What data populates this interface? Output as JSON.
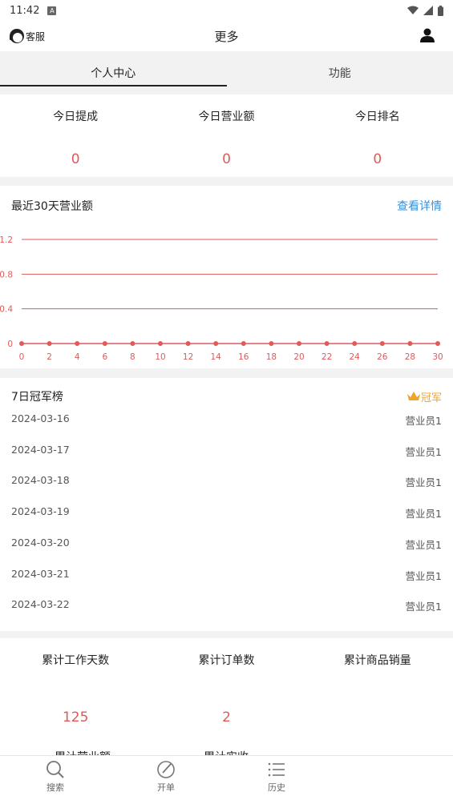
{
  "status": {
    "time": "11:42",
    "a_icon": "A"
  },
  "topbar": {
    "cs_label": "客服",
    "title": "更多"
  },
  "tabs": [
    {
      "label": "个人中心",
      "active": true
    },
    {
      "label": "功能",
      "active": false
    }
  ],
  "today": [
    {
      "label": "今日提成",
      "value": "0"
    },
    {
      "label": "今日营业额",
      "value": "0"
    },
    {
      "label": "今日排名",
      "value": "0"
    }
  ],
  "chart_header": {
    "title": "最近30天营业额",
    "link": "查看详情"
  },
  "chart_data": {
    "type": "line",
    "x": [
      0,
      1,
      2,
      3,
      4,
      5,
      6,
      7,
      8,
      9,
      10,
      11,
      12,
      13,
      14,
      15,
      16,
      17,
      18,
      19,
      20,
      21,
      22,
      23,
      24,
      25,
      26,
      27,
      28,
      29,
      30
    ],
    "series": [
      {
        "values": [
          0,
          0,
          0,
          0,
          0,
          0,
          0,
          0,
          0,
          0,
          0,
          0,
          0,
          0,
          0,
          0,
          0,
          0,
          0,
          0,
          0,
          0,
          0,
          0,
          0,
          0,
          0,
          0,
          0,
          0,
          0
        ]
      }
    ],
    "x_ticks": [
      "0",
      "2",
      "4",
      "6",
      "8",
      "10",
      "12",
      "14",
      "16",
      "18",
      "20",
      "22",
      "24",
      "26",
      "28",
      "30"
    ],
    "y_ticks": [
      "0",
      "0.4",
      "0.8",
      "1.2"
    ],
    "ylim": [
      0,
      1.2
    ],
    "xlim": [
      0,
      30
    ],
    "color": "#e05a5a",
    "grid": true
  },
  "rank": {
    "title": "7日冠军榜",
    "badge": "冠军",
    "rows": [
      {
        "date": "2024-03-16",
        "name": "营业员1"
      },
      {
        "date": "2024-03-17",
        "name": "营业员1"
      },
      {
        "date": "2024-03-18",
        "name": "营业员1"
      },
      {
        "date": "2024-03-19",
        "name": "营业员1"
      },
      {
        "date": "2024-03-20",
        "name": "营业员1"
      },
      {
        "date": "2024-03-21",
        "name": "营业员1"
      },
      {
        "date": "2024-03-22",
        "name": "营业员1"
      }
    ]
  },
  "totals": [
    {
      "label": "累计工作天数",
      "value": "125"
    },
    {
      "label": "累计订单数",
      "value": "2"
    },
    {
      "label": "累计商品销量",
      "value": ""
    }
  ],
  "totals_row2": [
    "累计营业额",
    "累计实收"
  ],
  "nav": [
    {
      "label": "搜索",
      "icon": "search-icon"
    },
    {
      "label": "开单",
      "icon": "edit-icon"
    },
    {
      "label": "历史",
      "icon": "list-icon"
    }
  ]
}
